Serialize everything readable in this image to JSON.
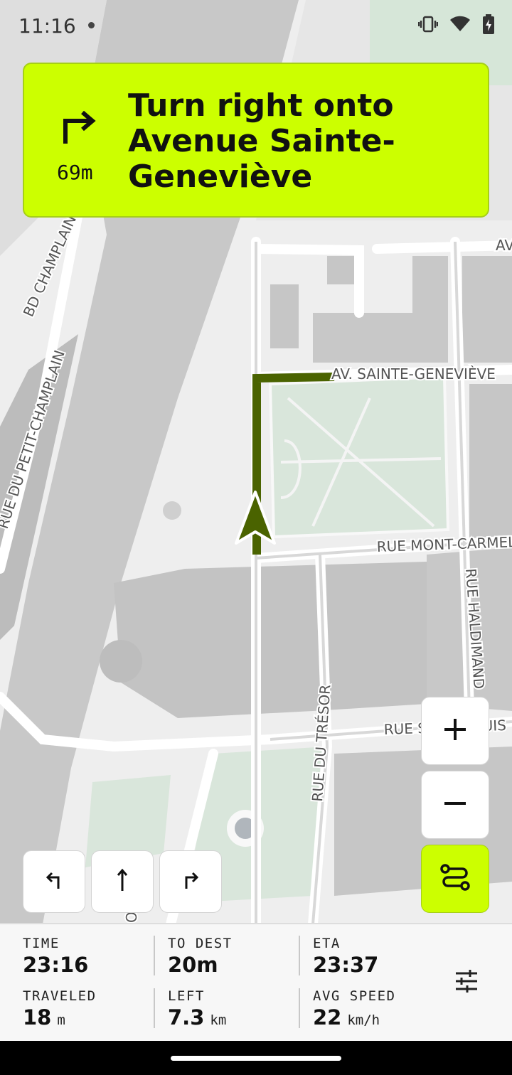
{
  "status_bar": {
    "time": "11:16",
    "icons": [
      "vibrate-icon",
      "wifi-icon",
      "battery-charging-icon"
    ]
  },
  "navigation": {
    "instruction": "Turn right onto Avenue Sainte-Geneviève",
    "distance": "69m",
    "maneuver_icon": "turn-right-icon",
    "banner_color": "#ccff00",
    "route_color": "#4a6300"
  },
  "map": {
    "street_labels": {
      "av_sainte_genevieve": "AV. SAINTE-GENEVIÈVE",
      "av_top_right": "AV",
      "rue_mont_carmel": "RUE MONT-CARMEL",
      "rue_haldimand": "RUE HALDIMAND",
      "rue_du_tresor": "RUE DU TRÉSOR",
      "rue_saint_louis": "RUE SAINT-LOUIS",
      "bd_champlain": "BD CHAMPLAIN",
      "rue_du_petit_champlain": "RUE DU PETIT-CHAMPLAIN",
      "rue_bottom_partial": "ORT"
    }
  },
  "controls": {
    "zoom_in": "+",
    "zoom_out": "−",
    "lanes": [
      "turn-left-lane-icon",
      "straight-lane-icon",
      "turn-right-lane-icon"
    ],
    "route_options_icon": "route-icon"
  },
  "trip": {
    "time": {
      "label": "TIME",
      "value": "23:16"
    },
    "to_dest": {
      "label": "TO DEST",
      "value": "20m"
    },
    "eta": {
      "label": "ETA",
      "value": "23:37"
    },
    "traveled": {
      "label": "TRAVELED",
      "value": "18",
      "unit": "m"
    },
    "left": {
      "label": "LEFT",
      "value": "7.3",
      "unit": "km"
    },
    "avg_speed": {
      "label": "AVG SPEED",
      "value": "22",
      "unit": "km/h"
    }
  }
}
